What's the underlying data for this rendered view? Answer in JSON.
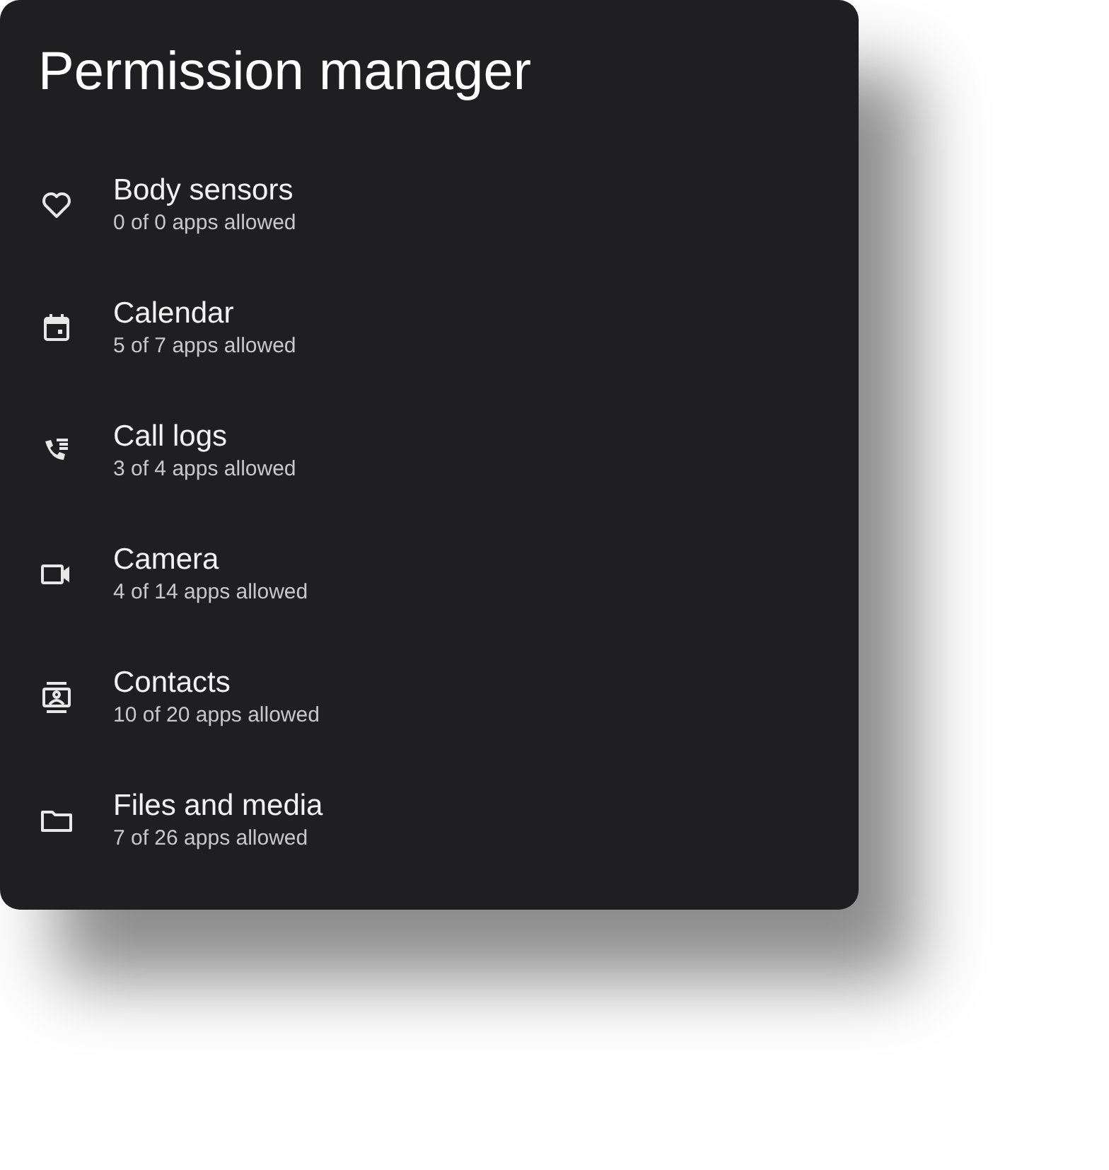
{
  "title": "Permission manager",
  "permissions": [
    {
      "kind": "heart",
      "label": "Body sensors",
      "summary": "0 of 0 apps allowed"
    },
    {
      "kind": "calendar",
      "label": "Calendar",
      "summary": "5 of 7 apps allowed"
    },
    {
      "kind": "calllog",
      "label": "Call logs",
      "summary": "3 of 4 apps allowed"
    },
    {
      "kind": "camera",
      "label": "Camera",
      "summary": "4 of 14 apps allowed"
    },
    {
      "kind": "contacts",
      "label": "Contacts",
      "summary": "10 of 20 apps allowed"
    },
    {
      "kind": "folder",
      "label": "Files and media",
      "summary": "7 of 26 apps allowed"
    }
  ]
}
